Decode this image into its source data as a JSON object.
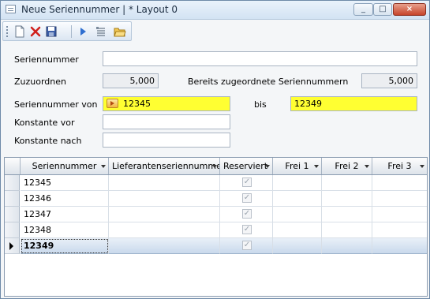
{
  "window": {
    "title": "Neue Seriennummer | * Layout 0",
    "controls": {
      "minimize": "_",
      "maximize": "□",
      "close": "×"
    }
  },
  "toolbar": {
    "buttons": [
      {
        "name": "new-icon",
        "tooltip": ""
      },
      {
        "name": "delete-icon",
        "tooltip": ""
      },
      {
        "name": "save-icon",
        "tooltip": ""
      },
      {
        "name": "play-icon",
        "tooltip": ""
      },
      {
        "name": "list-icon",
        "tooltip": ""
      },
      {
        "name": "open-folder-icon",
        "tooltip": ""
      }
    ]
  },
  "form": {
    "seriennummer_label": "Seriennummer",
    "seriennummer_value": "",
    "zuzuordnen_label": "Zuzuordnen",
    "zuzuordnen_value": "5,000",
    "bereits_label": "Bereits zugeordnete Seriennummern",
    "bereits_value": "5,000",
    "von_label": "Seriennummer von",
    "von_value": "12345",
    "bis_label": "bis",
    "bis_value": "12349",
    "konstante_vor_label": "Konstante vor",
    "konstante_vor_value": "",
    "konstante_nach_label": "Konstante nach",
    "konstante_nach_value": ""
  },
  "grid": {
    "columns": [
      "Seriennummer",
      "Lieferantenseriennummer",
      "Reserviert",
      "Frei 1",
      "Frei 2",
      "Frei 3"
    ],
    "rows": [
      {
        "seriennummer": "12345",
        "lieferant": "",
        "reserviert": true
      },
      {
        "seriennummer": "12346",
        "lieferant": "",
        "reserviert": true
      },
      {
        "seriennummer": "12347",
        "lieferant": "",
        "reserviert": true
      },
      {
        "seriennummer": "12348",
        "lieferant": "",
        "reserviert": true
      },
      {
        "seriennummer": "12349",
        "lieferant": "",
        "reserviert": true
      }
    ],
    "selected_row": 4,
    "check_glyph": "✓"
  },
  "colors": {
    "highlight_field": "#ffff32",
    "selection": "#c9d9ec"
  }
}
